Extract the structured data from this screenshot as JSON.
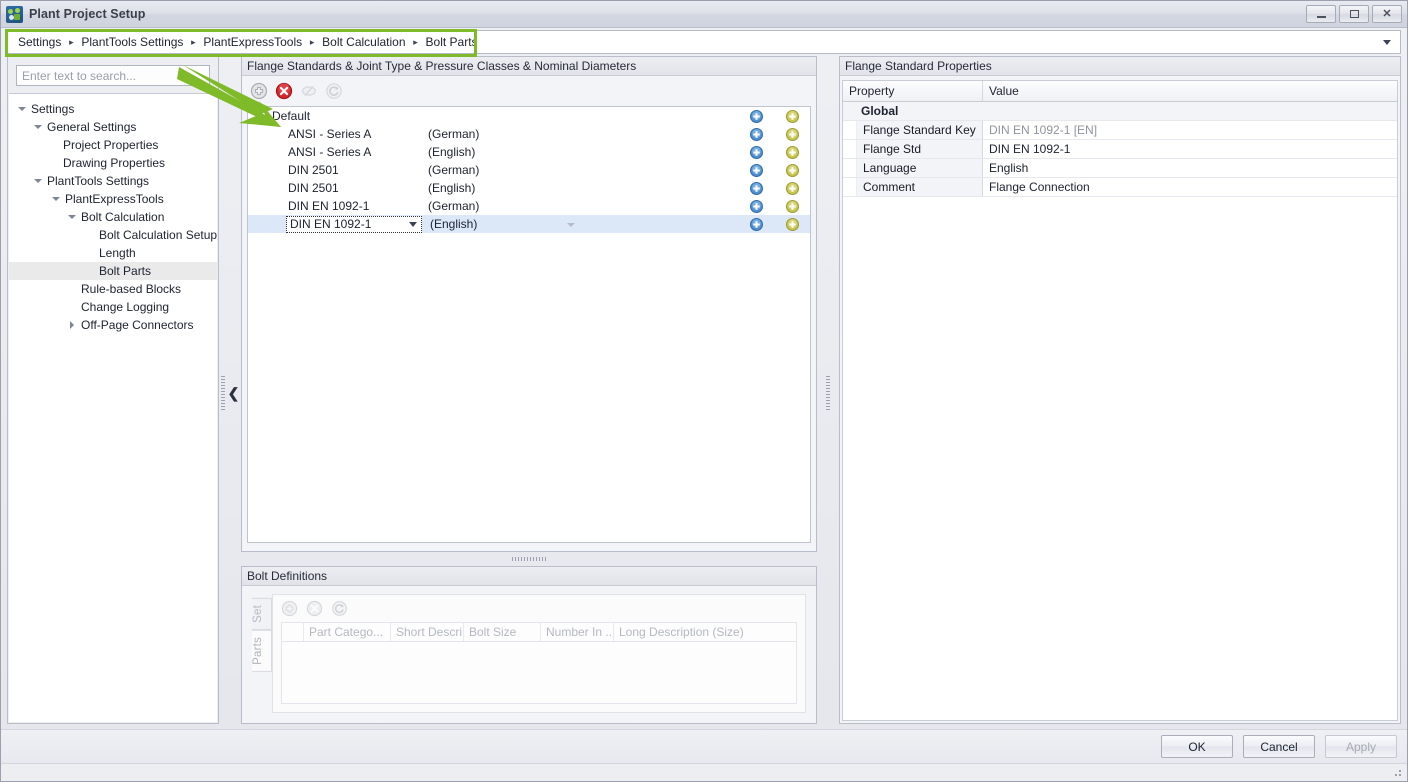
{
  "window": {
    "title": "Plant Project Setup",
    "app_icon": "plant-setup-icon",
    "minimize": "minimize-icon",
    "maximize": "maximize-icon",
    "close": "close-icon"
  },
  "breadcrumb": {
    "items": [
      "Settings",
      "PlantTools Settings",
      "PlantExpressTools",
      "Bolt Calculation",
      "Bolt Parts"
    ],
    "separator": "▸",
    "dropdown_icon": "chevron-down-icon",
    "highlight_color": "#7fba28"
  },
  "annotation": {
    "arrow_color": "#7fba28"
  },
  "search": {
    "placeholder": "Enter text to search...",
    "value": ""
  },
  "tree": [
    {
      "label": "Settings",
      "depth": 0,
      "state": "expanded",
      "selected": false
    },
    {
      "label": "General Settings",
      "depth": 1,
      "state": "expanded",
      "selected": false
    },
    {
      "label": "Project Properties",
      "depth": 2,
      "state": "leaf",
      "selected": false
    },
    {
      "label": "Drawing Properties",
      "depth": 2,
      "state": "leaf",
      "selected": false
    },
    {
      "label": "PlantTools Settings",
      "depth": 1,
      "state": "expanded",
      "selected": false
    },
    {
      "label": "PlantExpressTools",
      "depth": 2,
      "state": "expanded",
      "selected": false
    },
    {
      "label": "Bolt Calculation",
      "depth": 3,
      "state": "expanded",
      "selected": false
    },
    {
      "label": "Bolt Calculation Setup",
      "depth": 4,
      "state": "leaf",
      "selected": false
    },
    {
      "label": "Length",
      "depth": 4,
      "state": "leaf",
      "selected": false
    },
    {
      "label": "Bolt Parts",
      "depth": 4,
      "state": "leaf",
      "selected": true
    },
    {
      "label": "Rule-based Blocks",
      "depth": 3,
      "state": "leaf",
      "selected": false
    },
    {
      "label": "Change Logging",
      "depth": 3,
      "state": "leaf",
      "selected": false
    },
    {
      "label": "Off-Page Connectors",
      "depth": 3,
      "state": "collapsed",
      "selected": false
    }
  ],
  "left_splitter": {
    "grip": "splitter-grip",
    "collapse_icon": "chevron-left-icon"
  },
  "flange_panel": {
    "title": "Flange Standards & Joint Type & Pressure Classes & Nominal Diameters",
    "toolbar": [
      {
        "name": "add-flange-standard-button",
        "icon": "add-circle-icon",
        "enabled": true
      },
      {
        "name": "delete-flange-standard-button",
        "icon": "delete-circle-icon",
        "enabled": true
      },
      {
        "name": "copy-flange-standard-button",
        "icon": "copy-icon",
        "enabled": false
      },
      {
        "name": "refresh-flange-standards-button",
        "icon": "refresh-icon",
        "enabled": false
      }
    ],
    "rows": [
      {
        "name": "Default",
        "language": "",
        "depth": 0,
        "state": "expanded",
        "selected": false,
        "editing": false,
        "actions": true
      },
      {
        "name": "ANSI - Series A",
        "language": "(German)",
        "depth": 1,
        "state": "collapsed",
        "selected": false,
        "editing": false,
        "actions": true
      },
      {
        "name": "ANSI - Series A",
        "language": "(English)",
        "depth": 1,
        "state": "collapsed",
        "selected": false,
        "editing": false,
        "actions": true
      },
      {
        "name": "DIN 2501",
        "language": "(German)",
        "depth": 1,
        "state": "collapsed",
        "selected": false,
        "editing": false,
        "actions": true
      },
      {
        "name": "DIN 2501",
        "language": "(English)",
        "depth": 1,
        "state": "collapsed",
        "selected": false,
        "editing": false,
        "actions": true
      },
      {
        "name": "DIN EN 1092-1",
        "language": "(German)",
        "depth": 1,
        "state": "collapsed",
        "selected": false,
        "editing": false,
        "actions": true
      },
      {
        "name": "DIN EN 1092-1",
        "language": "(English)",
        "depth": 1,
        "state": "collapsed",
        "selected": true,
        "editing": true,
        "actions": true
      }
    ],
    "row_action_add": "add-row-icon",
    "row_action_add2": "add-nominal-diameter-icon"
  },
  "bolt_definitions": {
    "title": "Bolt Definitions",
    "vertical_tabs": [
      {
        "label": "Set",
        "active": false
      },
      {
        "label": "Parts",
        "active": true
      }
    ],
    "toolbar": [
      {
        "name": "add-bolt-part-button",
        "icon": "add-circle-icon",
        "enabled": false
      },
      {
        "name": "delete-bolt-part-button",
        "icon": "delete-circle-icon",
        "enabled": false
      },
      {
        "name": "refresh-bolt-parts-button",
        "icon": "refresh-icon",
        "enabled": false
      }
    ],
    "columns": [
      "",
      "Part Catego...",
      "Short Descri...",
      "Bolt Size",
      "Number In ...",
      "Long Description (Size)"
    ],
    "rows": []
  },
  "properties_panel": {
    "title": "Flange Standard Properties",
    "columns": [
      "Property",
      "Value"
    ],
    "groups": [
      {
        "label": "Global",
        "state": "expanded",
        "rows": [
          {
            "property": "Flange Standard Key",
            "value": "DIN EN 1092-1 [EN]",
            "readonly": true
          },
          {
            "property": "Flange Std",
            "value": "DIN EN 1092-1",
            "readonly": false
          },
          {
            "property": "Language",
            "value": "English",
            "readonly": false
          },
          {
            "property": "Comment",
            "value": "Flange Connection",
            "readonly": false
          }
        ]
      }
    ]
  },
  "footer": {
    "buttons": [
      {
        "label": "OK",
        "name": "ok-button",
        "enabled": true
      },
      {
        "label": "Cancel",
        "name": "cancel-button",
        "enabled": true
      },
      {
        "label": "Apply",
        "name": "apply-button",
        "enabled": false
      }
    ],
    "resize_grip": "resize-grip-icon"
  }
}
